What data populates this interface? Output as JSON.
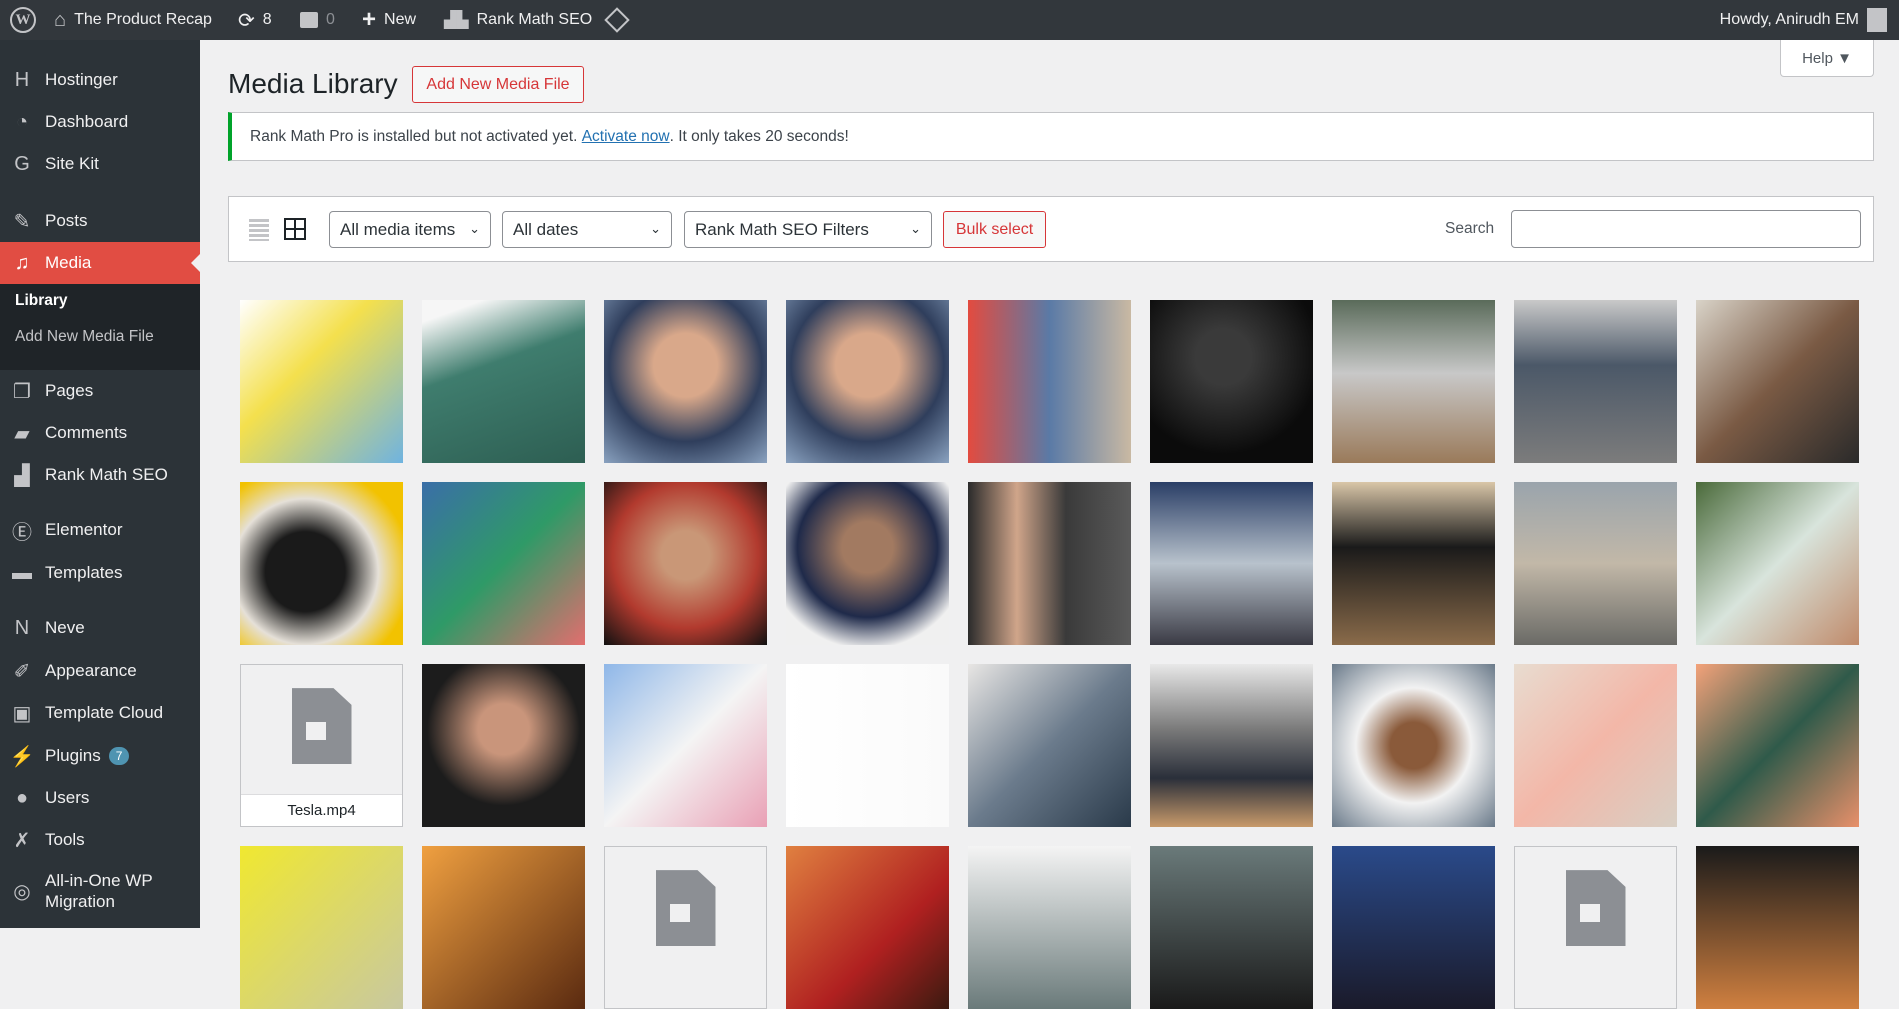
{
  "adminbar": {
    "site_name": "The Product Recap",
    "updates": "8",
    "comments": "0",
    "new_label": "New",
    "rankmath": "Rank Math SEO",
    "greeting": "Howdy, Anirudh EM"
  },
  "sidebar": {
    "items": [
      {
        "label": "Hostinger",
        "icon": "hostinger-icon"
      },
      {
        "label": "Dashboard",
        "icon": "dashboard-icon"
      },
      {
        "label": "Site Kit",
        "icon": "sitekit-icon"
      },
      {
        "label": "Posts",
        "icon": "pin-icon"
      },
      {
        "label": "Media",
        "icon": "media-icon"
      },
      {
        "label": "Pages",
        "icon": "pages-icon"
      },
      {
        "label": "Comments",
        "icon": "comment-icon"
      },
      {
        "label": "Rank Math SEO",
        "icon": "rankmath-icon"
      },
      {
        "label": "Elementor",
        "icon": "elementor-icon"
      },
      {
        "label": "Templates",
        "icon": "folder-icon"
      },
      {
        "label": "Neve",
        "icon": "neve-icon"
      },
      {
        "label": "Appearance",
        "icon": "brush-icon"
      },
      {
        "label": "Template Cloud",
        "icon": "template-cloud-icon"
      },
      {
        "label": "Plugins",
        "icon": "plugin-icon",
        "badge": "7"
      },
      {
        "label": "Users",
        "icon": "user-icon"
      },
      {
        "label": "Tools",
        "icon": "wrench-icon"
      },
      {
        "label": "All-in-One WP",
        "label2": "Migration",
        "icon": "migration-icon"
      }
    ],
    "submenu": {
      "library": "Library",
      "add_new": "Add New Media File"
    }
  },
  "page": {
    "title": "Media Library",
    "add_new": "Add New Media File",
    "help": "Help ▼"
  },
  "notice": {
    "text": "Rank Math Pro is installed but not activated yet. ",
    "link": "Activate now",
    "after": ". It only takes 20 seconds!"
  },
  "toolbar": {
    "filter_type": "All media items",
    "filter_date": "All dates",
    "filter_seo": "Rank Math SEO Filters",
    "bulk": "Bulk select",
    "search_label": "Search",
    "search_value": ""
  },
  "colors": {
    "accent": "#e14d43",
    "notice_border": "#00a32a",
    "link": "#2271b1"
  },
  "grid": {
    "items": [
      {
        "bg": "linear-gradient(135deg,#fff 0%,#f4e04d 40%,#6fb3e0 100%)"
      },
      {
        "bg": "linear-gradient(160deg,#f6f6f6 10%,#3f7d6e 40%,#2d5e52 100%)"
      },
      {
        "bg": "radial-gradient(circle at 50% 40%,#d9a88a 25%,#2f3e5c 60%,#8aa2c0 100%)"
      },
      {
        "bg": "radial-gradient(circle at 50% 40%,#d9a88a 25%,#2f3e5c 60%,#8aa2c0 100%)"
      },
      {
        "bg": "linear-gradient(90deg,#e34b3f 0%,#5a7aa6 50%,#c9b9a3 100%)"
      },
      {
        "bg": "radial-gradient(circle at 45% 35%,#3a3a3a 20%,#0b0b0b 70%)"
      },
      {
        "bg": "linear-gradient(180deg,#5a6b5a 0%,#c8c8c8 45%,#9a7a5a 100%)"
      },
      {
        "bg": "linear-gradient(180deg,#c9c9c9 0%,#4b5868 40%,#7c7c7c 100%)"
      },
      {
        "bg": "linear-gradient(135deg,#d9d3c8 0%,#7a5a44 50%,#2a2a2a 100%)"
      },
      {
        "bg": "radial-gradient(circle at 40% 55%,#1a1a1a 30%,#e5e0d8 55%,#f2c200 80%)"
      },
      {
        "bg": "linear-gradient(135deg,#3a6ea8 0%,#2f9a67 50%,#e26e6e 100%)"
      },
      {
        "bg": "radial-gradient(circle at 50% 45%,#c99777 20%,#b23a2e 60%,#111 100%)"
      },
      {
        "bg": "radial-gradient(circle at 50% 40%,#a27a61 20%,#1f2a4a 55%,#f0f0f0 80%)"
      },
      {
        "bg": "linear-gradient(90deg,#2b2b2b 0%,#d0a58a 30%,#3a3a3a 60%,#5a5a5a 100%)"
      },
      {
        "bg": "linear-gradient(180deg,#2a3e66 0%,#b8c2cc 50%,#3a3a44 100%)"
      },
      {
        "bg": "linear-gradient(180deg,#d9c6a8 0%,#1a1a1a 40%,#8a6b4a 100%)"
      },
      {
        "bg": "linear-gradient(180deg,#9aa4ac 0%,#c2b8a8 50%,#6a6a66 100%)"
      },
      {
        "bg": "linear-gradient(135deg,#4a6a3a 0%,#d8e4dc 50%,#c08a6a 100%)"
      },
      {
        "video": true,
        "caption": "Tesla.mp4"
      },
      {
        "bg": "radial-gradient(circle at 50% 40%,#c9957b 20%,#1c1c1c 60%)"
      },
      {
        "bg": "linear-gradient(135deg,#8fb7e8 0%,#f4f4f4 50%,#e9a0b5 100%)"
      },
      {
        "bg": "linear-gradient(90deg,#fff 0%,#fafafa 100%)"
      },
      {
        "bg": "linear-gradient(135deg,#e8e6e4 0%,#6b7b8c 50%,#2a3a4a 100%)"
      },
      {
        "bg": "linear-gradient(180deg,#e8e8e8 0%,#7a7a7a 40%,#2a2f3a 70%,#c89a6a 100%)"
      },
      {
        "bg": "radial-gradient(circle at 50% 50%,#8a5a3a 20%,#f2f2f2 50%,#6a7a8a 100%)"
      },
      {
        "bg": "linear-gradient(135deg,#e8dcd0 0%,#f3b7a8 50%,#d8cfc4 100%)"
      },
      {
        "bg": "linear-gradient(135deg,#f3a27a 0%,#2f5a4a 50%,#e8906a 100%)"
      },
      {
        "bg": "linear-gradient(135deg,#f0e830 0%,#c8c8a0 100%)"
      },
      {
        "bg": "linear-gradient(135deg,#f0a040 0%,#5a2a10 100%)"
      },
      {
        "video": true
      },
      {
        "bg": "linear-gradient(135deg,#e08040 0%,#b02020 60%,#3a1a10 100%)"
      },
      {
        "bg": "linear-gradient(180deg,#f4f4f4 0%,#6a7a7a 100%)"
      },
      {
        "bg": "linear-gradient(180deg,#6a7a7a 0%,#1a1a1a 100%)"
      },
      {
        "bg": "linear-gradient(180deg,#2a4a8a 0%,#1a1a2a 100%)"
      },
      {
        "video": true
      },
      {
        "bg": "linear-gradient(180deg,#1a1a1a 0%,#d08040 100%)"
      }
    ]
  }
}
